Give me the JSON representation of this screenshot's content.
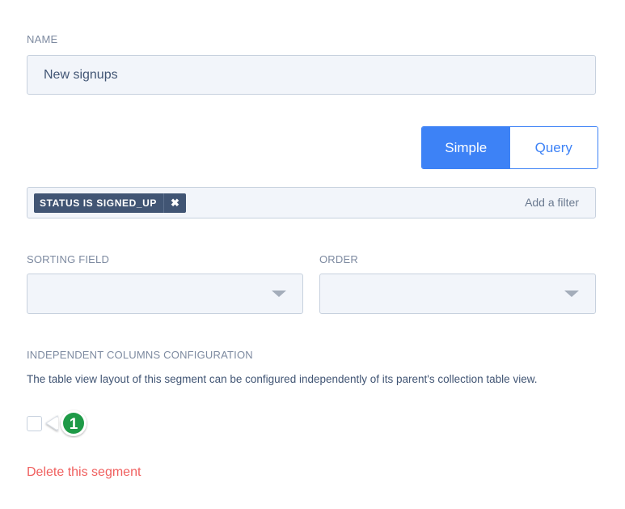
{
  "name_field": {
    "label": "NAME",
    "value": "New signups"
  },
  "mode_toggle": {
    "options": [
      "Simple",
      "Query"
    ],
    "selected": "Simple"
  },
  "filters": {
    "tags": [
      {
        "label": "STATUS IS SIGNED_UP",
        "remove_icon": "close-icon",
        "remove_glyph": "✖"
      }
    ],
    "add_filter_label": "Add a filter"
  },
  "sorting": {
    "sorting_field_label": "SORTING FIELD",
    "sorting_field_value": "",
    "order_label": "ORDER",
    "order_value": ""
  },
  "independent_columns": {
    "label": "INDEPENDENT COLUMNS CONFIGURATION",
    "description": "The table view layout of this segment can be configured independently of its parent's collection table view.",
    "checked": false,
    "callout_number": "1"
  },
  "delete_link": "Delete this segment",
  "colors": {
    "accent": "#3d82f6",
    "danger": "#f0605f",
    "tag_bg": "#415574",
    "callout_green": "#1e9a47"
  }
}
